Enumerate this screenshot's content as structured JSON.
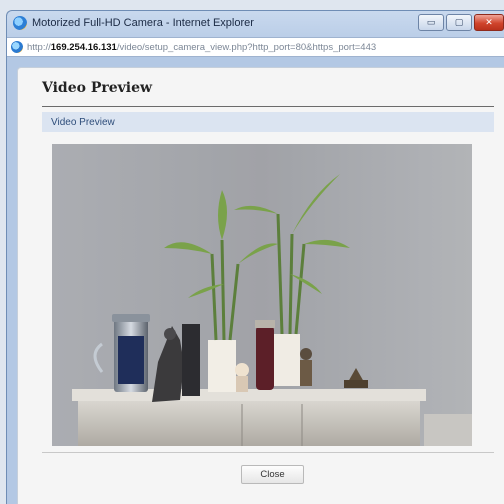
{
  "window": {
    "title": "Motorized Full-HD Camera - Internet Explorer",
    "url_prefix": "http://",
    "url_host": "169.254.16.131",
    "url_path": "/video/setup_camera_view.php?http_port=80&https_port=443",
    "minimize_glyph": "▭",
    "maximize_glyph": "▢",
    "close_glyph": "✕",
    "icon": "internet-explorer-icon"
  },
  "page": {
    "title": "Video Preview",
    "section_label": "Video Preview",
    "close_label": "Close"
  },
  "video": {
    "description_icon": "camera-preview-image"
  }
}
